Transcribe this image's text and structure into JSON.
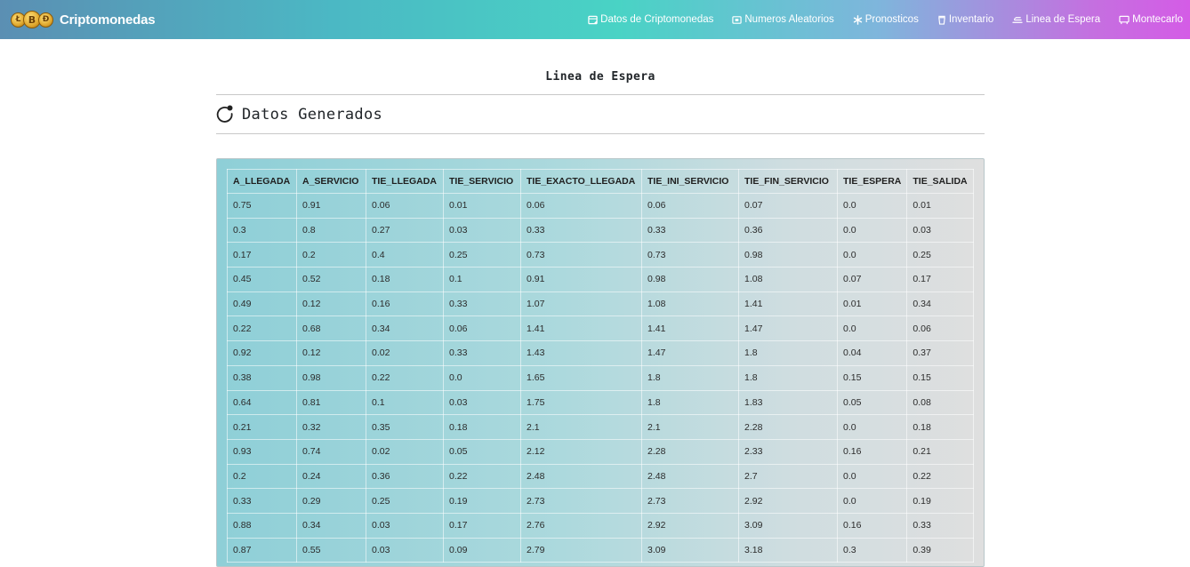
{
  "navbar": {
    "brand": "Criptomonedas",
    "coins": [
      "Ł",
      "B",
      "Ð"
    ],
    "items": [
      {
        "label": "Datos de Criptomonedas",
        "icon": "table-icon"
      },
      {
        "label": "Numeros Aleatorios",
        "icon": "dice-icon"
      },
      {
        "label": "Pronosticos",
        "icon": "asterisk-icon"
      },
      {
        "label": "Inventario",
        "icon": "cup-icon"
      },
      {
        "label": "Linea de Espera",
        "icon": "queue-icon"
      },
      {
        "label": "Montecarlo",
        "icon": "monitor-icon"
      }
    ]
  },
  "page": {
    "title": "Linea de Espera",
    "section_title": "Datos Generados",
    "section_icon": "loading-icon"
  },
  "table": {
    "columns": [
      "A_LLEGADA",
      "A_SERVICIO",
      "TIE_LLEGADA",
      "TIE_SERVICIO",
      "TIE_EXACTO_LLEGADA",
      "TIE_INI_SERVICIO",
      "TIE_FIN_SERVICIO",
      "TIE_ESPERA",
      "TIE_SALIDA"
    ],
    "rows": [
      [
        "0.75",
        "0.91",
        "0.06",
        "0.01",
        "0.06",
        "0.06",
        "0.07",
        "0.0",
        "0.01"
      ],
      [
        "0.3",
        "0.8",
        "0.27",
        "0.03",
        "0.33",
        "0.33",
        "0.36",
        "0.0",
        "0.03"
      ],
      [
        "0.17",
        "0.2",
        "0.4",
        "0.25",
        "0.73",
        "0.73",
        "0.98",
        "0.0",
        "0.25"
      ],
      [
        "0.45",
        "0.52",
        "0.18",
        "0.1",
        "0.91",
        "0.98",
        "1.08",
        "0.07",
        "0.17"
      ],
      [
        "0.49",
        "0.12",
        "0.16",
        "0.33",
        "1.07",
        "1.08",
        "1.41",
        "0.01",
        "0.34"
      ],
      [
        "0.22",
        "0.68",
        "0.34",
        "0.06",
        "1.41",
        "1.41",
        "1.47",
        "0.0",
        "0.06"
      ],
      [
        "0.92",
        "0.12",
        "0.02",
        "0.33",
        "1.43",
        "1.47",
        "1.8",
        "0.04",
        "0.37"
      ],
      [
        "0.38",
        "0.98",
        "0.22",
        "0.0",
        "1.65",
        "1.8",
        "1.8",
        "0.15",
        "0.15"
      ],
      [
        "0.64",
        "0.81",
        "0.1",
        "0.03",
        "1.75",
        "1.8",
        "1.83",
        "0.05",
        "0.08"
      ],
      [
        "0.21",
        "0.32",
        "0.35",
        "0.18",
        "2.1",
        "2.1",
        "2.28",
        "0.0",
        "0.18"
      ],
      [
        "0.93",
        "0.74",
        "0.02",
        "0.05",
        "2.12",
        "2.28",
        "2.33",
        "0.16",
        "0.21"
      ],
      [
        "0.2",
        "0.24",
        "0.36",
        "0.22",
        "2.48",
        "2.48",
        "2.7",
        "0.0",
        "0.22"
      ],
      [
        "0.33",
        "0.29",
        "0.25",
        "0.19",
        "2.73",
        "2.73",
        "2.92",
        "0.0",
        "0.19"
      ],
      [
        "0.88",
        "0.34",
        "0.03",
        "0.17",
        "2.76",
        "2.92",
        "3.09",
        "0.16",
        "0.33"
      ],
      [
        "0.87",
        "0.55",
        "0.03",
        "0.09",
        "2.79",
        "3.09",
        "3.18",
        "0.3",
        "0.39"
      ]
    ]
  }
}
